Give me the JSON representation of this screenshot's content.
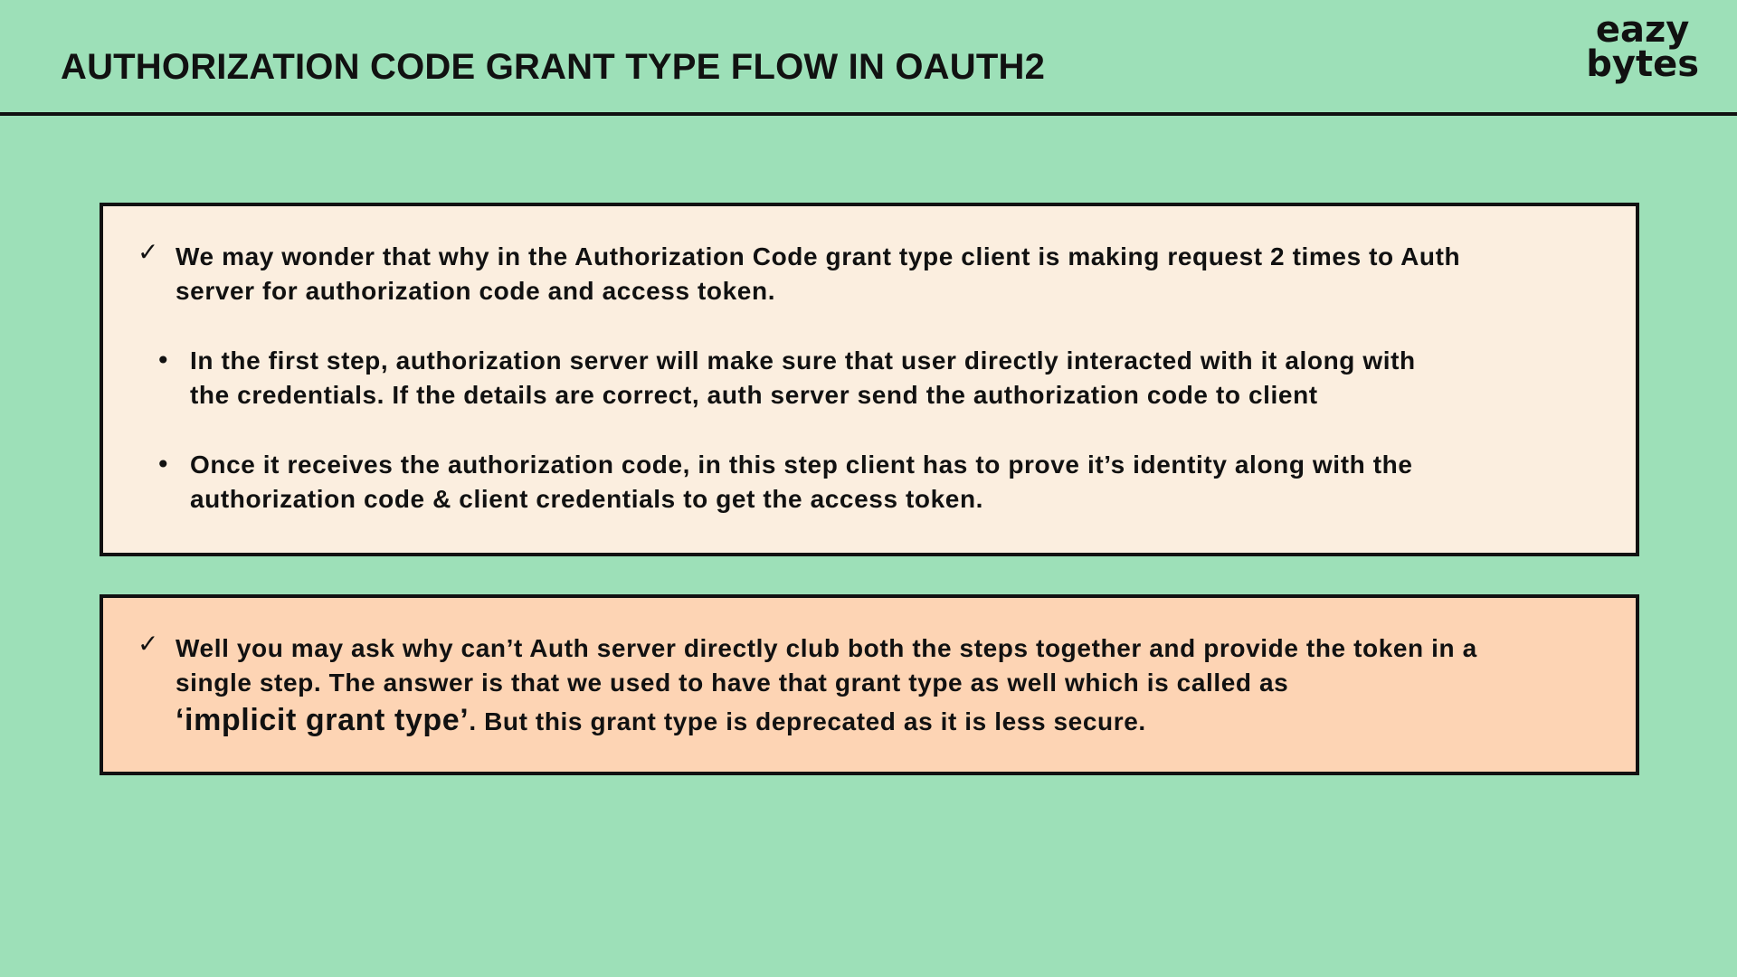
{
  "header": {
    "title": "AUTHORIZATION CODE GRANT TYPE FLOW IN OAUTH2",
    "logo_line1": "eazy",
    "logo_line2": "bytes"
  },
  "box1": {
    "check_mark": "✓",
    "check_text_line1": "We may wonder that why in the Authorization Code grant type client is making request 2 times to Auth",
    "check_text_line2": "server for authorization code and access token.",
    "bullet_mark": "•",
    "bullet1_line1": "In the first step, authorization server will make sure that user directly interacted with it along with",
    "bullet1_line2": "the credentials. If the details are correct, auth server send the authorization code to client",
    "bullet2_line1": "Once it receives the authorization code, in this step client has to prove it’s identity along with the",
    "bullet2_line2": "authorization code & client credentials to get the access token."
  },
  "box2": {
    "check_mark": "✓",
    "line1": "Well you may ask why can’t Auth server directly club both the steps together and provide the token in a",
    "line2": "single step. The answer is that we used to have that grant type as well which is called as",
    "term": "‘implicit grant type’",
    "line3_rest": ". But this grant type is deprecated as it is less secure."
  }
}
